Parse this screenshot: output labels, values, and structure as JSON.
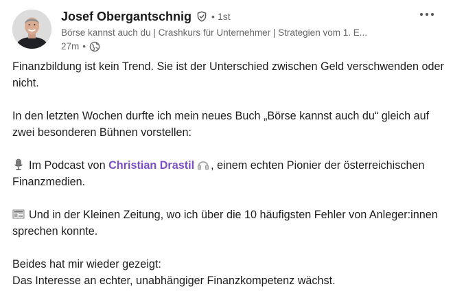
{
  "author": {
    "name": "Josef Obergantschnig",
    "degree": "1st",
    "headline": "Börse kannst auch du | Crashkurs für Unternehmer | Strategien vom 1. E...",
    "time": "27m"
  },
  "icons": {
    "verified": "verified-shield-icon",
    "visibility": "globe-icon",
    "more": "more-dots-icon",
    "microphone": "microphone-emoji",
    "headphones": "headphones-emoji",
    "newspaper": "newspaper-emoji"
  },
  "colors": {
    "mention": "#7b4fc4",
    "secondary_text": "#666666"
  },
  "post": {
    "p1": "Finanzbildung ist kein Trend. Sie ist der Unterschied zwischen Geld verschwenden oder nicht.",
    "p2": "In den letzten Wochen durfte ich mein neues Buch „Börse kannst auch du“ gleich auf zwei besonderen Bühnen vorstellen:",
    "p3_before": "Im Podcast von ",
    "p3_mention": "Christian Drastil",
    "p3_after": ", einem echten Pionier der österreichischen Finanzmedien.",
    "p4": "Und in der Kleinen Zeitung, wo ich über die 10 häufigsten Fehler von Anleger:innen sprechen konnte.",
    "p5_line1": "Beides hat mir wieder gezeigt:",
    "p5_line2": "Das Interesse an echter, unabhängiger Finanzkompetenz wächst."
  }
}
